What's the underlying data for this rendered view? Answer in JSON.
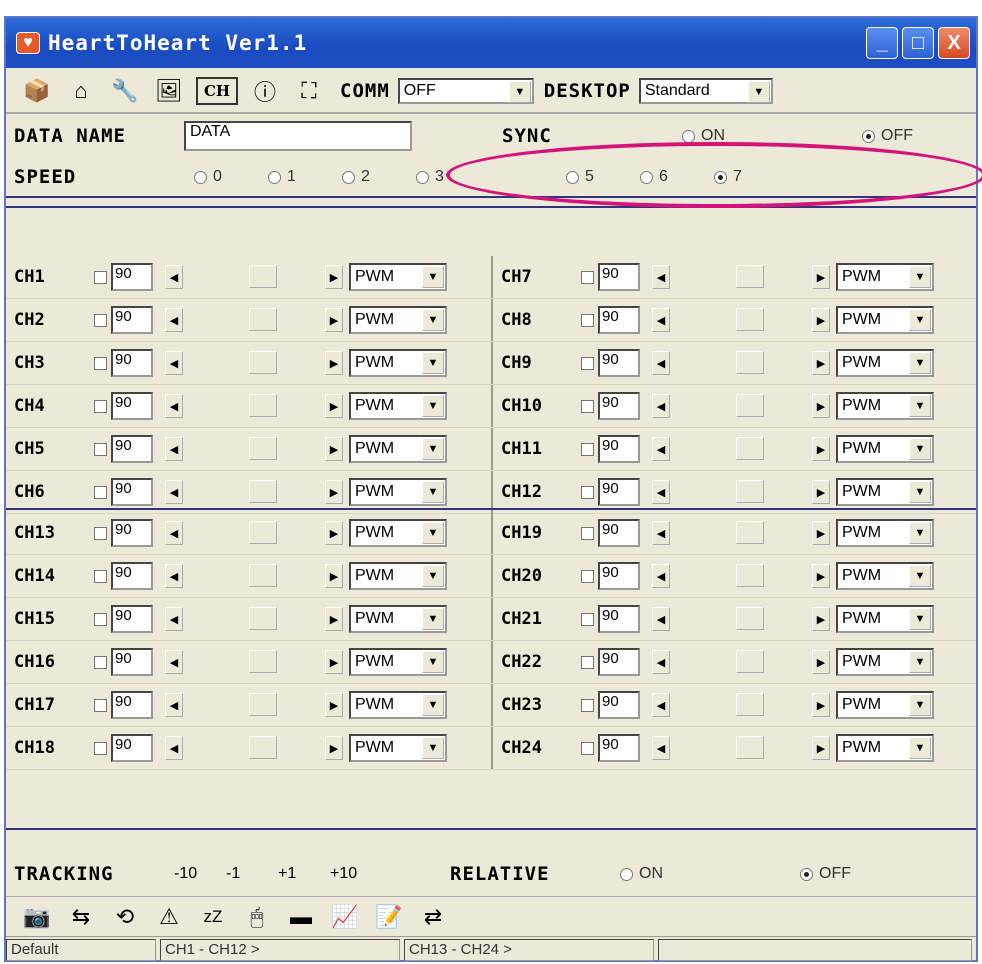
{
  "window": {
    "title": "HeartToHeart Ver1.1",
    "minimize": "_",
    "maximize": "□",
    "close": "X"
  },
  "toolbar": {
    "ch_button": "CH",
    "comm_label": "COMM",
    "comm_value": "OFF",
    "desktop_label": "DESKTOP",
    "desktop_value": "Standard"
  },
  "settings": {
    "data_name_label": "DATA NAME",
    "data_name_value": "DATA",
    "sync_label": "SYNC",
    "sync_on": "ON",
    "sync_off": "OFF",
    "speed_label": "SPEED",
    "speed_options": [
      "0",
      "1",
      "2",
      "3",
      "5",
      "6",
      "7"
    ]
  },
  "channels_left_top": [
    "CH1",
    "CH2",
    "CH3",
    "CH4",
    "CH5",
    "CH6"
  ],
  "channels_right_top": [
    "CH7",
    "CH8",
    "CH9",
    "CH10",
    "CH11",
    "CH12"
  ],
  "channels_left_bottom": [
    "CH13",
    "CH14",
    "CH15",
    "CH16",
    "CH17",
    "CH18"
  ],
  "channels_right_bottom": [
    "CH19",
    "CH20",
    "CH21",
    "CH22",
    "CH23",
    "CH24"
  ],
  "channel_value": "90",
  "channel_mode": "PWM",
  "tracking": {
    "label": "TRACKING",
    "m10": "-10",
    "m1": "-1",
    "p1": "+1",
    "p10": "+10"
  },
  "relative": {
    "label": "RELATIVE",
    "on": "ON",
    "off": "OFF"
  },
  "bottom_icons": {
    "sleep": "zZ"
  },
  "status": {
    "p1": "Default",
    "p2": "CH1 - CH12 >",
    "p3": "CH13 - CH24 >"
  }
}
